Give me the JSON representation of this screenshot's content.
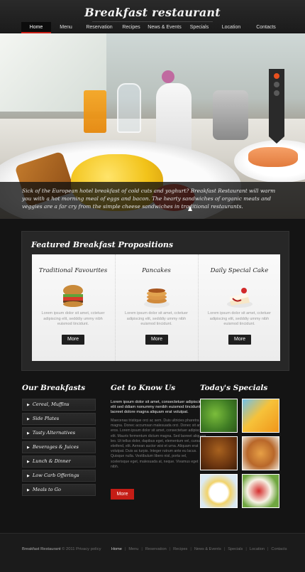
{
  "header": {
    "brand": "Breakfast restaurant",
    "nav": [
      "Home",
      "Menu",
      "Reservation",
      "Recipes",
      "News & Events",
      "Specials",
      "Location",
      "Contacts"
    ],
    "active_nav": "Home"
  },
  "hero": {
    "caption": "Sick of the European hotel breakfast of cold cuts and yoghurt? Breakfast Restaurant will warm you with a hot morning meal of eggs and bacon. The hearty sandwiches of organic meats and veggies are a far cry from the simple cheese sandwiches in traditional restaurants.",
    "slides": 3,
    "active_slide": 1
  },
  "featured": {
    "title": "Featured Breakfast Propositions",
    "items": [
      {
        "title": "Traditional Favourites",
        "text": "Lorem ipsum dolor sit amet, cctetuer adipiscing elit, sedddiy ummy nibh euismod tincidunt.",
        "button": "More"
      },
      {
        "title": "Pancakes",
        "text": "Lorem ipsum dolor sit amet, cctetuer adipiscing elit, sedddiy ummy nibh euismod tincidunt.",
        "button": "More"
      },
      {
        "title": "Daily Special Cake",
        "text": "Lorem ipsum dolor sit amet, cctetuer adipiscing elit, sedddiy ummy nibh euismod tincidunt.",
        "button": "More"
      }
    ]
  },
  "breakfasts": {
    "title": "Our Breakfasts",
    "items": [
      "Cereal, Muffins",
      "Side Plates",
      "Tasty Alternatives",
      "Beverages & Juices",
      "Lunch & Dinner",
      "Low Carb Offerings",
      "Meals to Go"
    ]
  },
  "know": {
    "title": "Get to Know Us",
    "lead": "Lorem ipsum dolor sit amet, consectetuer adipiscing elit sed ddiam nonummy nenibh euismod tincidunt ut laoreet dolore magna aliquam erat volutpat.",
    "body": "Maecenas tristique orci ac sem. Duis ultricies pharetra magna. Donec accumsan malesuada orci. Donec sit amet eros. Lorem ipsum dolor sit amet, consectetuer adipiscing elit. Mauris fermentum dictum magna. Sed laoreet aliquam leo. Ut tellus dolor, dapibus eget, elementum vel, cursus eleifend, elit. Aenean auctor wisi et urna. Aliquam erat volutpat. Duis ac turpis. Integer rutrum ante eu lacus. Quisque nulla. Vestibulum libero nisl, porta vel, scelerisque eget, malesuada at, neque. Vivamus eget nibh.",
    "button": "More"
  },
  "specials": {
    "title": "Today's Specials",
    "tiles": [
      "salad-icon",
      "juice-icon",
      "muffins-icon",
      "croissant-icon",
      "plate-icon",
      "fruit-icon"
    ]
  },
  "footer": {
    "brand": "Breakfast Restaurant",
    "copyright": "© 2011",
    "privacy": "Privacy policy",
    "nav": [
      "Home",
      "Menu",
      "Reservation",
      "Recipes",
      "News & Events",
      "Specials",
      "Location",
      "Contacts"
    ]
  },
  "colors": {
    "accent": "#c51d16",
    "slider_active": "#e8501e",
    "background": "#141414"
  }
}
